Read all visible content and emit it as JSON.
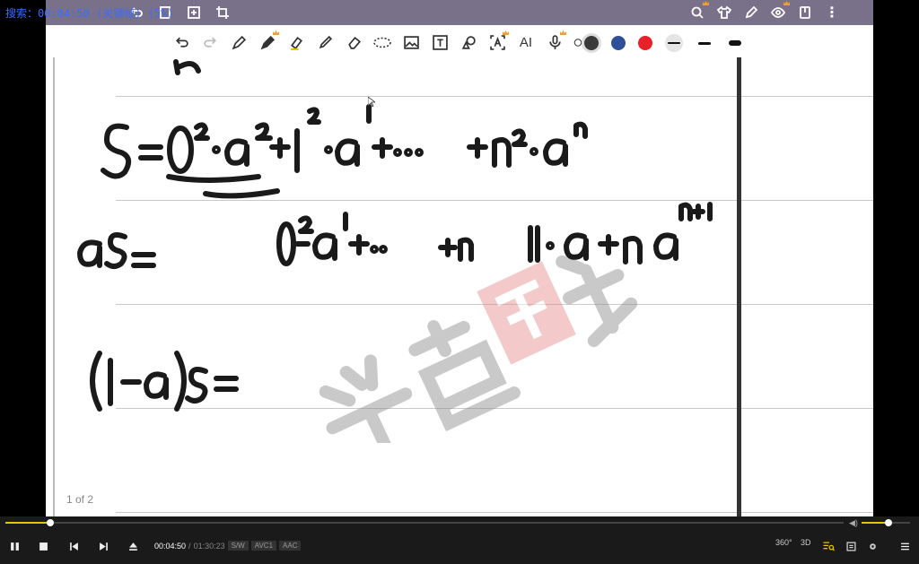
{
  "search_overlay": "搜索：00:04:50 (关键帧) (5%)",
  "top_bar": {
    "left_icons": [
      "undo-icon",
      "book-icon",
      "add-page-icon",
      "crop-icon"
    ],
    "right_icons": [
      "search-icon",
      "shirt-icon",
      "pen-edit-icon",
      "eye-icon",
      "bookmark-icon",
      "more-icon"
    ]
  },
  "toolbar": {
    "tools": [
      "undo-icon",
      "redo-icon",
      "pen-icon",
      "pencil-icon",
      "highlighter-icon",
      "marker-icon",
      "eraser-icon",
      "lasso-icon",
      "image-icon",
      "textbox-icon",
      "shapes-icon",
      "text-recognition-icon",
      "ai-icon",
      "microphone-icon",
      "more-tools-icon"
    ],
    "ai_label": "AI",
    "colors": [
      "#3a3a3a",
      "#2f4f9a",
      "#e8202a"
    ],
    "strokes": [
      "thin",
      "medium",
      "thick"
    ]
  },
  "page": {
    "page_count": "1 of 2"
  },
  "player": {
    "current_time": "00:04:50",
    "separator": "/",
    "total_time": "01:30:23",
    "chips": [
      "S/W",
      "AVC1",
      "AAC"
    ],
    "progress_fraction": 0.054,
    "volume_fraction": 0.52,
    "right_labels": {
      "vr": "360°",
      "three_d": "3D"
    }
  }
}
